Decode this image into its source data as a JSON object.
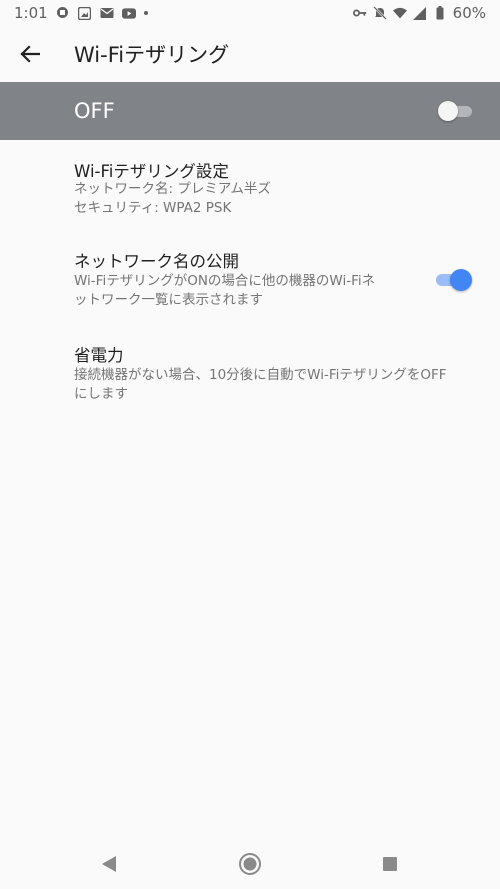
{
  "status_bar": {
    "time": "1:01",
    "battery": "60%",
    "icons": [
      "notification-icon",
      "photo-icon",
      "mail-icon",
      "youtube-icon",
      "dot-icon",
      "vpn-key-icon",
      "mute-icon",
      "wifi-icon",
      "signal-icon",
      "battery-icon"
    ]
  },
  "app_bar": {
    "title": "Wi-Fiテザリング",
    "back_icon": "back-arrow-icon"
  },
  "master": {
    "label": "OFF",
    "state": false
  },
  "prefs": [
    {
      "title": "Wi-Fiテザリング設定",
      "line1": "ネットワーク名: プレミアム半ズ",
      "line2": "セキュリティ: WPA2 PSK"
    },
    {
      "title": "ネットワーク名の公開",
      "line1": "Wi-FiテザリングがONの場合に他の機器のWi-Fiネ",
      "line2": "ットワーク一覧に表示されます",
      "toggle": true
    },
    {
      "title": "省電力",
      "line1": "接続機器がない場合、10分後に自動でWi-FiテザリングをOFF",
      "line2": "にします"
    }
  ],
  "colors": {
    "accent": "#4285f4",
    "master_bg": "#808489",
    "background": "#fafafa"
  },
  "nav": {
    "icons": [
      "back-triangle-icon",
      "home-circle-icon",
      "recents-square-icon"
    ]
  }
}
